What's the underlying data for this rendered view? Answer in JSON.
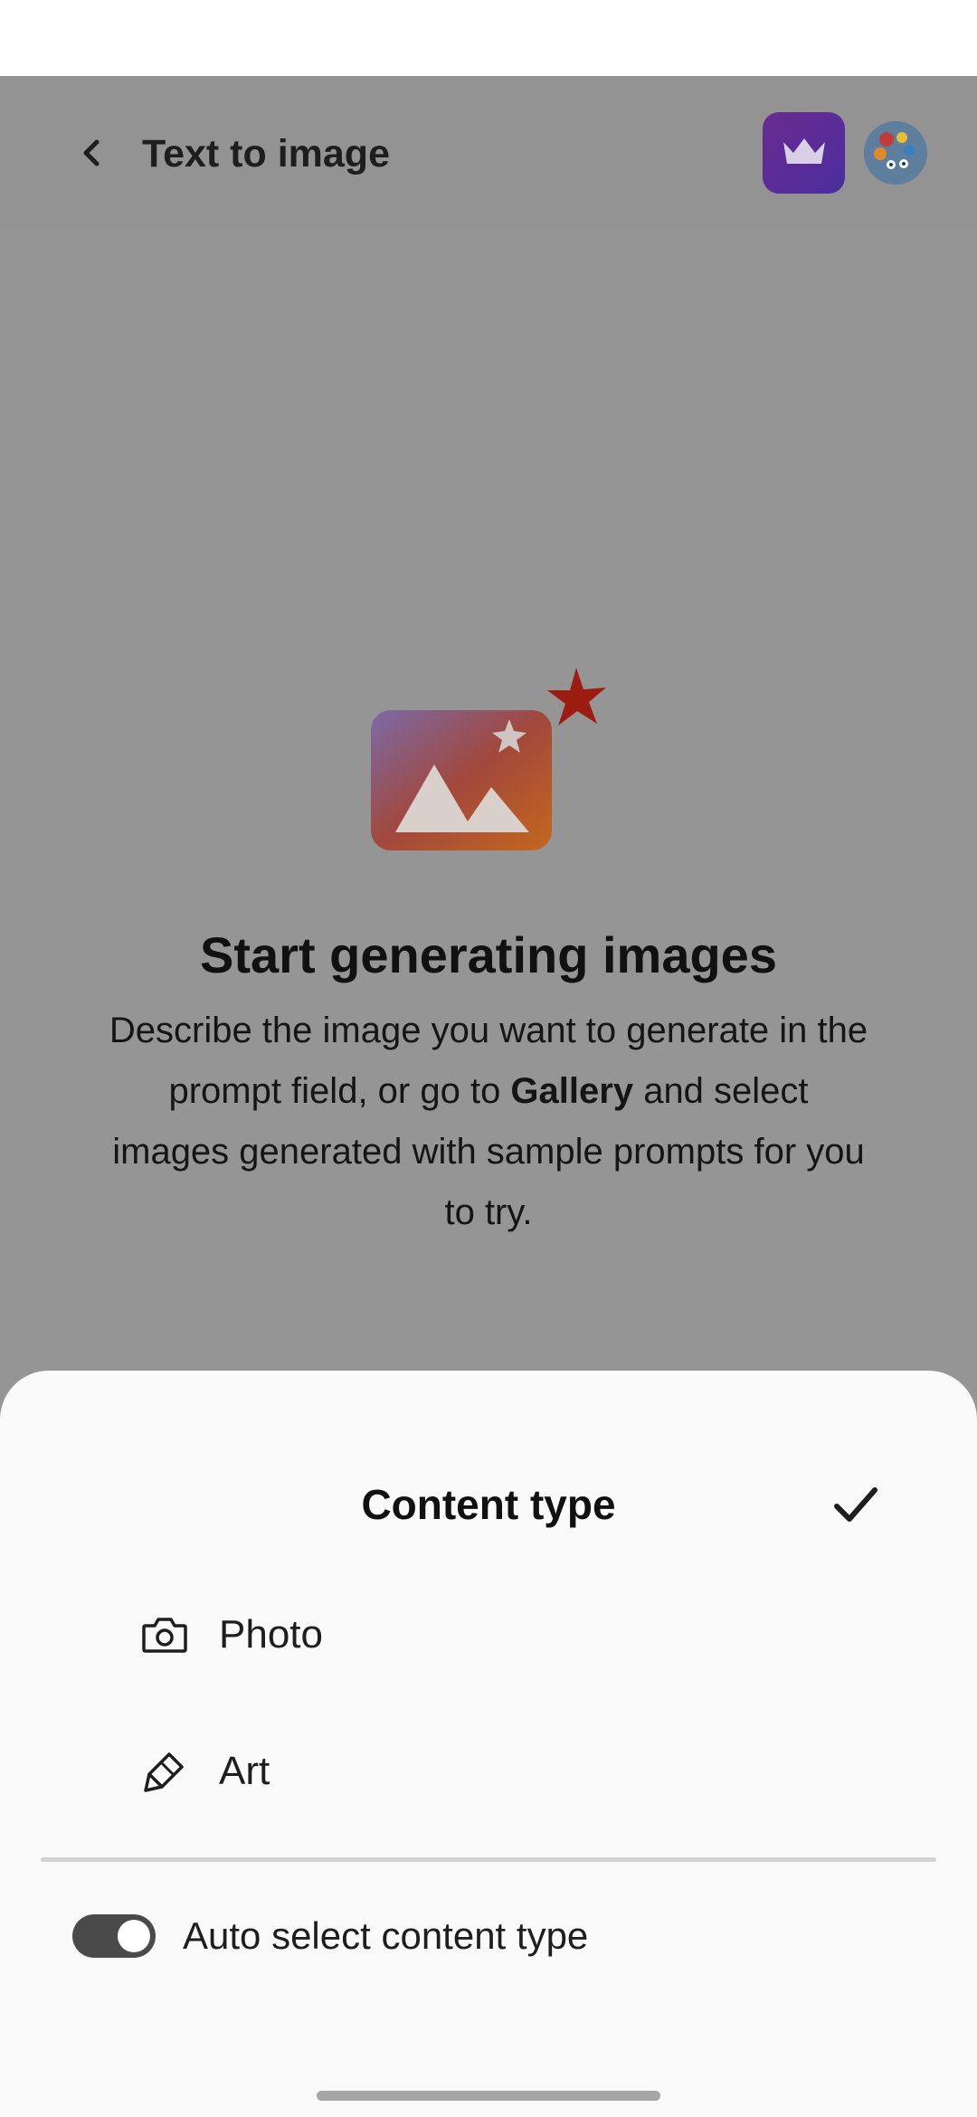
{
  "header": {
    "title": "Text to image"
  },
  "empty_state": {
    "title": "Start generating images",
    "desc_part1": "Describe the image you want to generate in the prompt field, or go to ",
    "desc_bold": "Gallery",
    "desc_part2": " and select images generated with sample prompts for you to try."
  },
  "sheet": {
    "title": "Content type",
    "options": [
      {
        "label": "Photo",
        "icon": "camera-icon"
      },
      {
        "label": "Art",
        "icon": "brush-icon"
      }
    ],
    "toggle": {
      "label": "Auto select content type",
      "on": true
    }
  },
  "colors": {
    "overlay_bg": "#959595",
    "premium_gradient_start": "#6a2c8f",
    "premium_gradient_end": "#4b2d9f",
    "toggle_on": "#4a4a4a"
  }
}
